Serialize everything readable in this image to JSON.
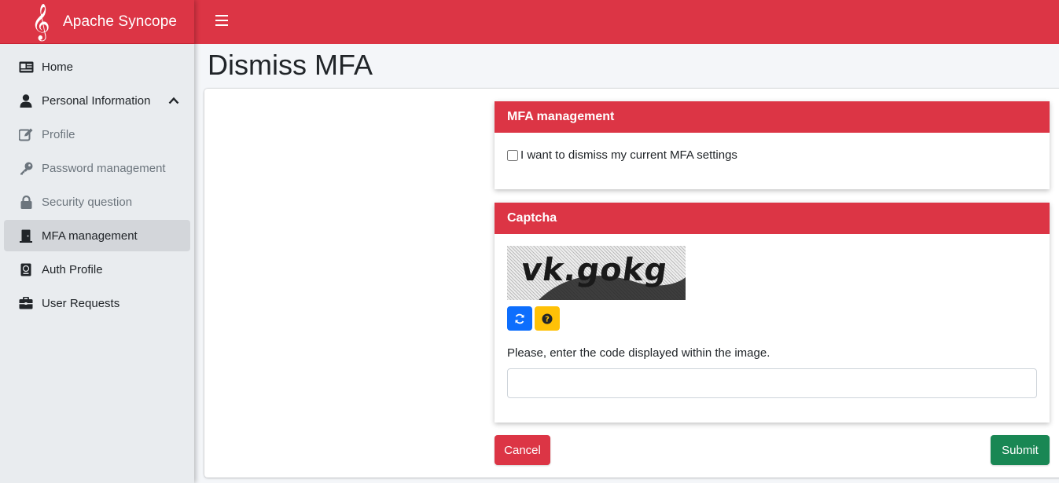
{
  "brand": {
    "name": "Apache Syncope"
  },
  "sidebar": {
    "items": [
      {
        "label": "Home",
        "icon": "id-card-icon"
      },
      {
        "label": "Personal Information",
        "icon": "user-icon"
      },
      {
        "label": "Profile",
        "icon": "edit-icon"
      },
      {
        "label": "Password management",
        "icon": "key-icon"
      },
      {
        "label": "Security question",
        "icon": "lock-icon"
      },
      {
        "label": "MFA management",
        "icon": "door-icon"
      },
      {
        "label": "Auth Profile",
        "icon": "passport-icon"
      },
      {
        "label": "User Requests",
        "icon": "briefcase-icon"
      }
    ]
  },
  "page": {
    "title": "Dismiss MFA"
  },
  "mfa": {
    "header": "MFA management",
    "checkbox_label": "I want to dismiss my current MFA settings"
  },
  "captcha": {
    "header": "Captcha",
    "image_text": "vk.gokg",
    "instruction": "Please, enter the code displayed within the image.",
    "input_value": ""
  },
  "actions": {
    "cancel": "Cancel",
    "submit": "Submit"
  },
  "colors": {
    "brand": "#dc3545",
    "primary": "#0d6efd",
    "warning": "#ffc107",
    "success": "#198754"
  }
}
